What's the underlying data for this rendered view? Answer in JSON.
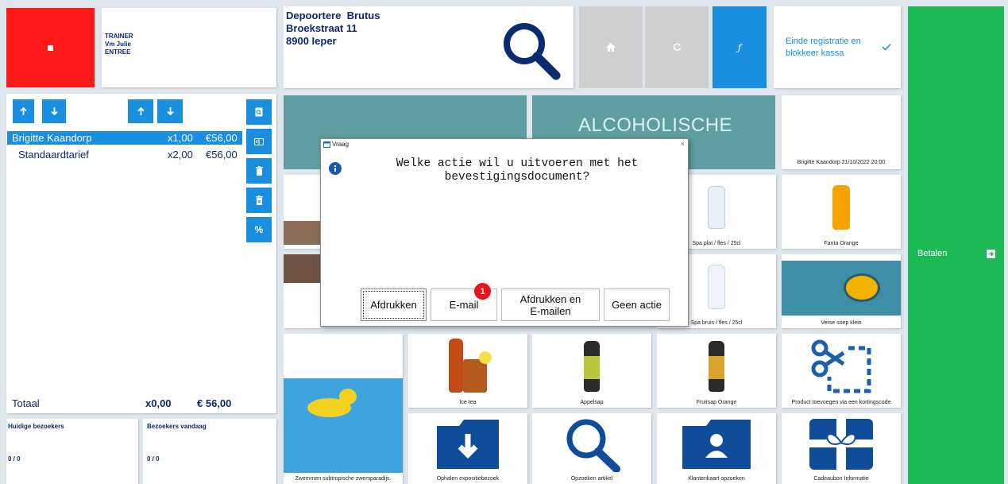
{
  "header": {
    "trainer": "TRAINER",
    "user": "Vm Julie",
    "location": "ENTREE",
    "customer": {
      "name": "Depoortere  Brutus",
      "street": "Broekstraat 11",
      "city": "8900 Ieper"
    },
    "end_registration_label": "Einde registratie en blokkeer kassa"
  },
  "order": {
    "lines": [
      {
        "name": "Brigitte Kaandorp",
        "qty": "x1,00",
        "price": "€56,00",
        "selected": true
      },
      {
        "name": "Standaardtarief",
        "qty": "x2,00",
        "price": "€56,00",
        "selected": false
      }
    ],
    "total_label": "Totaal",
    "total_qty": "x0,00",
    "total_amount": "€ 56,00"
  },
  "stats": {
    "current_visitors_label": "Huidige bezoekers",
    "current_visitors_value": "0 / 0",
    "visitors_today_label": "Bezoekers vandaag",
    "visitors_today_value": "0 / 0"
  },
  "categories": {
    "alcoholic": "ALCOHOLISCHE",
    "event_label": "Brigitte Kaandorp 21/10/2022 20:00"
  },
  "products": {
    "spa_plat": "Spa plat / fles / 25cl",
    "fanta": "Fanta Orange",
    "spa_bruis": "Spa bruis / fles / 25cl",
    "soup": "Verse soep klein",
    "swim": "Zwemmen subtropische zwemparadijs.",
    "ice_tea": "Ice tea",
    "appelsap": "Appelsap",
    "fruitsap": "Fruitsap Orange",
    "coupon": "Product toevoegen via een kortingscode",
    "fetch_expo": "Ophalen expositiebezoek",
    "lookup_article": "Opzoeken artikel",
    "customer_card": "Klantenkaart opzoeken",
    "voucher_info": "Cadeaubon Informatie"
  },
  "pay": {
    "label": "Betalen"
  },
  "dialog": {
    "title": "Vraag",
    "message_line1": "Welke actie wil u uitvoeren met het",
    "message_line2": "bevestigingsdocument?",
    "buttons": {
      "print": "Afdrukken",
      "email": "E-mail",
      "print_email_1": "Afdrukken en",
      "print_email_2": "E-mailen",
      "none": "Geen actie"
    },
    "badge": "1"
  },
  "colors": {
    "stop": "#ff1a1a",
    "accent_blue": "#1a8fe0",
    "pay_green": "#1db954",
    "category_teal": "#5f9ea0",
    "navy": "#0b2a6f"
  }
}
